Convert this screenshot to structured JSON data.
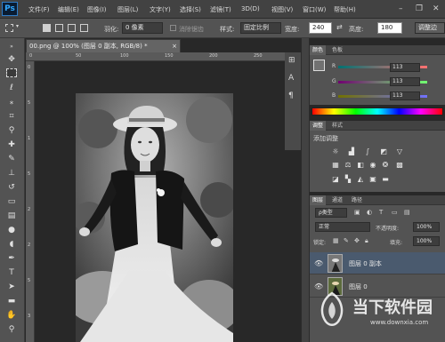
{
  "app": {
    "logo": "Ps"
  },
  "menu": {
    "items": [
      "文件(F)",
      "编辑(E)",
      "图像(I)",
      "图层(L)",
      "文字(Y)",
      "选择(S)",
      "滤镜(T)",
      "3D(D)",
      "视图(V)",
      "窗口(W)",
      "帮助(H)"
    ]
  },
  "window_controls": {
    "minimize": "–",
    "restore": "❐",
    "close": "✕"
  },
  "options": {
    "feather_label": "羽化:",
    "feather_value": "0 像素",
    "antialias_label": "消除锯齿",
    "style_label": "样式:",
    "style_value": "固定比例",
    "width_label": "宽度:",
    "width_value": "240",
    "height_label": "高度:",
    "height_value": "180",
    "refine_button": "调整边"
  },
  "document": {
    "tab_title": "00.png @ 100% (图层 0 副本, RGB/8) *",
    "close": "×"
  },
  "ruler": {
    "top_ticks": [
      "0",
      "50",
      "100",
      "150",
      "200",
      "250"
    ],
    "left_ticks": [
      "0",
      "5",
      "1",
      "5",
      "2",
      "2",
      "5",
      "3"
    ]
  },
  "color_panel": {
    "tabs": [
      "颜色",
      "色板"
    ],
    "channels": [
      {
        "label": "R",
        "value": "113"
      },
      {
        "label": "G",
        "value": "113"
      },
      {
        "label": "B",
        "value": "113"
      }
    ]
  },
  "adjustments_panel": {
    "tabs": [
      "调整",
      "样式"
    ],
    "title": "添加调整"
  },
  "layers_panel": {
    "tabs": [
      "图层",
      "通道",
      "路径"
    ],
    "kind_label": "ρ类型",
    "blend_mode": "正常",
    "opacity_label": "不透明度:",
    "opacity_value": "100%",
    "lock_label": "锁定:",
    "fill_label": "填充:",
    "fill_value": "100%",
    "layers": [
      {
        "name": "图层 0 副本",
        "selected": true
      },
      {
        "name": "图层 0",
        "selected": false
      }
    ]
  },
  "watermark": {
    "text": "当下软件园",
    "url": "www.downxia.com"
  },
  "colors": {
    "accent": "#31a8ff",
    "selected_layer": "#4a5a6e",
    "panel": "#535353",
    "canvas": "#282828"
  }
}
